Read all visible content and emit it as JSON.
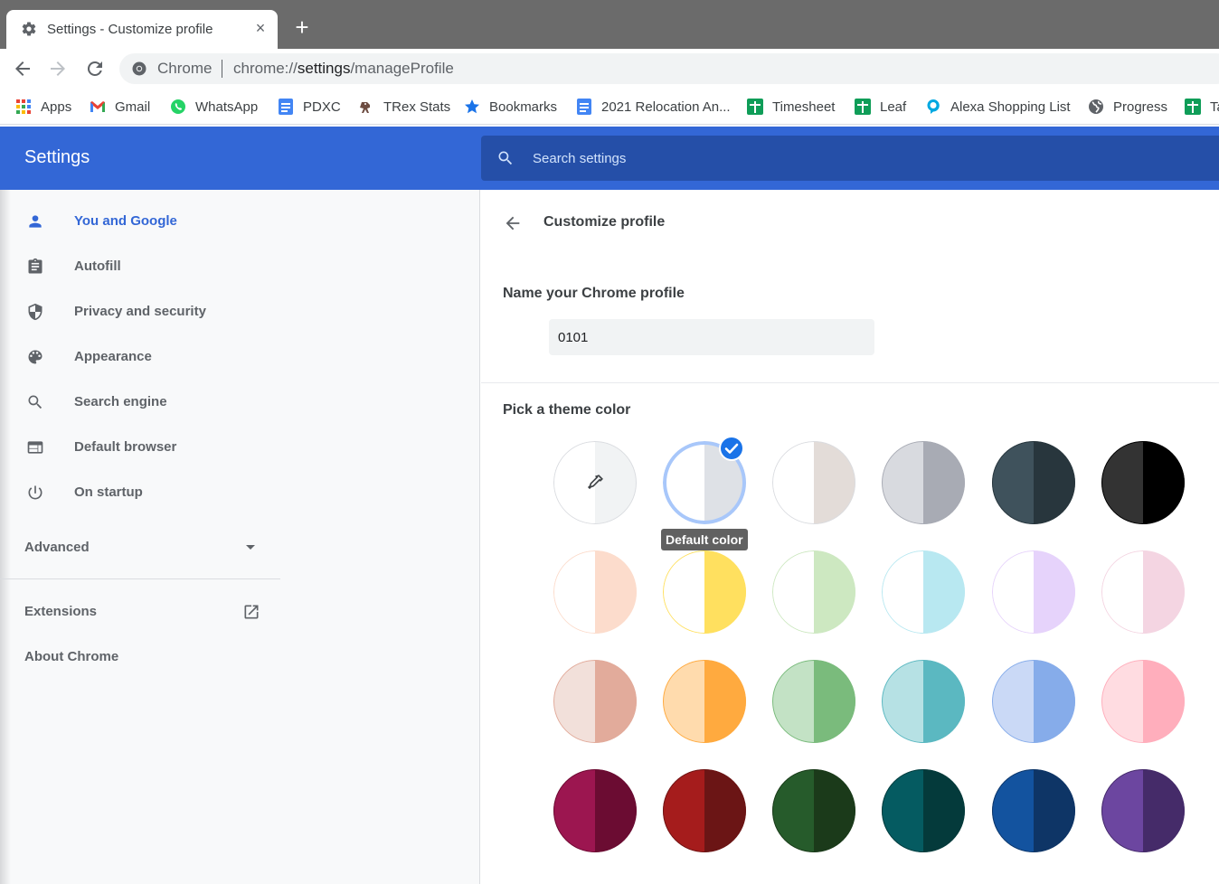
{
  "browser": {
    "tab": {
      "title": "Settings - Customize profile",
      "icon": "gear-icon",
      "close_label": "×"
    },
    "new_tab_label": "+",
    "omnibox": {
      "site_label": "Chrome",
      "url_prefix": "chrome://",
      "url_host": "settings",
      "url_path": "/manageProfile"
    },
    "bookmarks": [
      {
        "label": "Apps",
        "icon": "apps-grid-icon"
      },
      {
        "label": "Gmail",
        "icon": "gmail-icon"
      },
      {
        "label": "WhatsApp",
        "icon": "whatsapp-icon"
      },
      {
        "label": "PDXC",
        "icon": "google-docs-icon"
      },
      {
        "label": "TRex Stats",
        "icon": "trex-icon"
      },
      {
        "label": "Bookmarks",
        "icon": "star-icon"
      },
      {
        "label": "2021 Relocation An...",
        "icon": "google-docs-icon"
      },
      {
        "label": "Timesheet",
        "icon": "google-sheets-icon"
      },
      {
        "label": "Leaf",
        "icon": "google-sheets-icon"
      },
      {
        "label": "Alexa Shopping List",
        "icon": "alexa-icon"
      },
      {
        "label": "Progress",
        "icon": "globe-icon"
      },
      {
        "label": "Ta",
        "icon": "google-sheets-icon"
      }
    ]
  },
  "settings": {
    "title": "Settings",
    "search_placeholder": "Search settings",
    "sidebar": {
      "items": [
        {
          "label": "You and Google",
          "icon": "person-icon",
          "active": true
        },
        {
          "label": "Autofill",
          "icon": "clipboard-icon",
          "active": false
        },
        {
          "label": "Privacy and security",
          "icon": "shield-icon",
          "active": false
        },
        {
          "label": "Appearance",
          "icon": "palette-icon",
          "active": false
        },
        {
          "label": "Search engine",
          "icon": "search-icon",
          "active": false
        },
        {
          "label": "Default browser",
          "icon": "browser-window-icon",
          "active": false
        },
        {
          "label": "On startup",
          "icon": "power-icon",
          "active": false
        }
      ],
      "advanced_label": "Advanced",
      "extensions_label": "Extensions",
      "about_label": "About Chrome"
    },
    "main": {
      "page_title": "Customize profile",
      "name_label": "Name your Chrome profile",
      "name_value": "0101",
      "theme_label": "Pick a theme color",
      "tooltip": "Default color",
      "selected_index": 1,
      "swatches": [
        {
          "name": "custom-color-picker",
          "left": "#ffffff",
          "right": "#f1f3f4",
          "border": "#dadce0"
        },
        {
          "name": "default-color",
          "left": "#ffffff",
          "right": "#dee1e6",
          "border": "#a8c7fa"
        },
        {
          "name": "warm-grey",
          "left": "#ffffff",
          "right": "#e3dcd8",
          "border": "#dadce0"
        },
        {
          "name": "cool-grey",
          "left": "#d8dadf",
          "right": "#a8abb4",
          "border": "#a8abb4"
        },
        {
          "name": "midnight-blue",
          "left": "#3f525c",
          "right": "#28363d",
          "border": "#28363d"
        },
        {
          "name": "black",
          "left": "#333333",
          "right": "#000000",
          "border": "#000000"
        },
        {
          "name": "beige-white",
          "left": "#ffffff",
          "right": "#fcdccc",
          "border": "#fcdccc"
        },
        {
          "name": "yellow-white",
          "left": "#ffffff",
          "right": "#ffe05f",
          "border": "#ffe05f"
        },
        {
          "name": "green-white",
          "left": "#ffffff",
          "right": "#cde8c1",
          "border": "#cde8c1"
        },
        {
          "name": "light-teal-white",
          "left": "#ffffff",
          "right": "#b8e8f1",
          "border": "#b8e8f1"
        },
        {
          "name": "light-purple-white",
          "left": "#ffffff",
          "right": "#e6d3fb",
          "border": "#e6d3fb"
        },
        {
          "name": "pink-white",
          "left": "#ffffff",
          "right": "#f4d5e2",
          "border": "#f4d5e2"
        },
        {
          "name": "beige",
          "left": "#f2e0da",
          "right": "#e2ab9b",
          "border": "#e2ab9b"
        },
        {
          "name": "orange",
          "left": "#ffdbad",
          "right": "#ffaa3f",
          "border": "#ffaa3f"
        },
        {
          "name": "light-green",
          "left": "#c3e2c5",
          "right": "#7abb7c",
          "border": "#7abb7c"
        },
        {
          "name": "light-teal",
          "left": "#b6e1e4",
          "right": "#5bb8c1",
          "border": "#5bb8c1"
        },
        {
          "name": "light-blue",
          "left": "#cad9f6",
          "right": "#86acea",
          "border": "#86acea"
        },
        {
          "name": "light-pink",
          "left": "#ffdce1",
          "right": "#ffaebc",
          "border": "#ffaebc"
        },
        {
          "name": "dark-pink-red",
          "left": "#9c1650",
          "right": "#6b0c32",
          "border": "#6b0c32"
        },
        {
          "name": "dark-red-orange",
          "left": "#a51c1c",
          "right": "#6b1515",
          "border": "#6b1515"
        },
        {
          "name": "dark-green",
          "left": "#265b2b",
          "right": "#1b3a1a",
          "border": "#1b3a1a"
        },
        {
          "name": "dark-teal",
          "left": "#055b61",
          "right": "#043a3b",
          "border": "#043a3b"
        },
        {
          "name": "dark-blue",
          "left": "#13539f",
          "right": "#0e3566",
          "border": "#0e3566"
        },
        {
          "name": "purple",
          "left": "#6c46a0",
          "right": "#452b69",
          "border": "#452b69"
        }
      ]
    }
  }
}
